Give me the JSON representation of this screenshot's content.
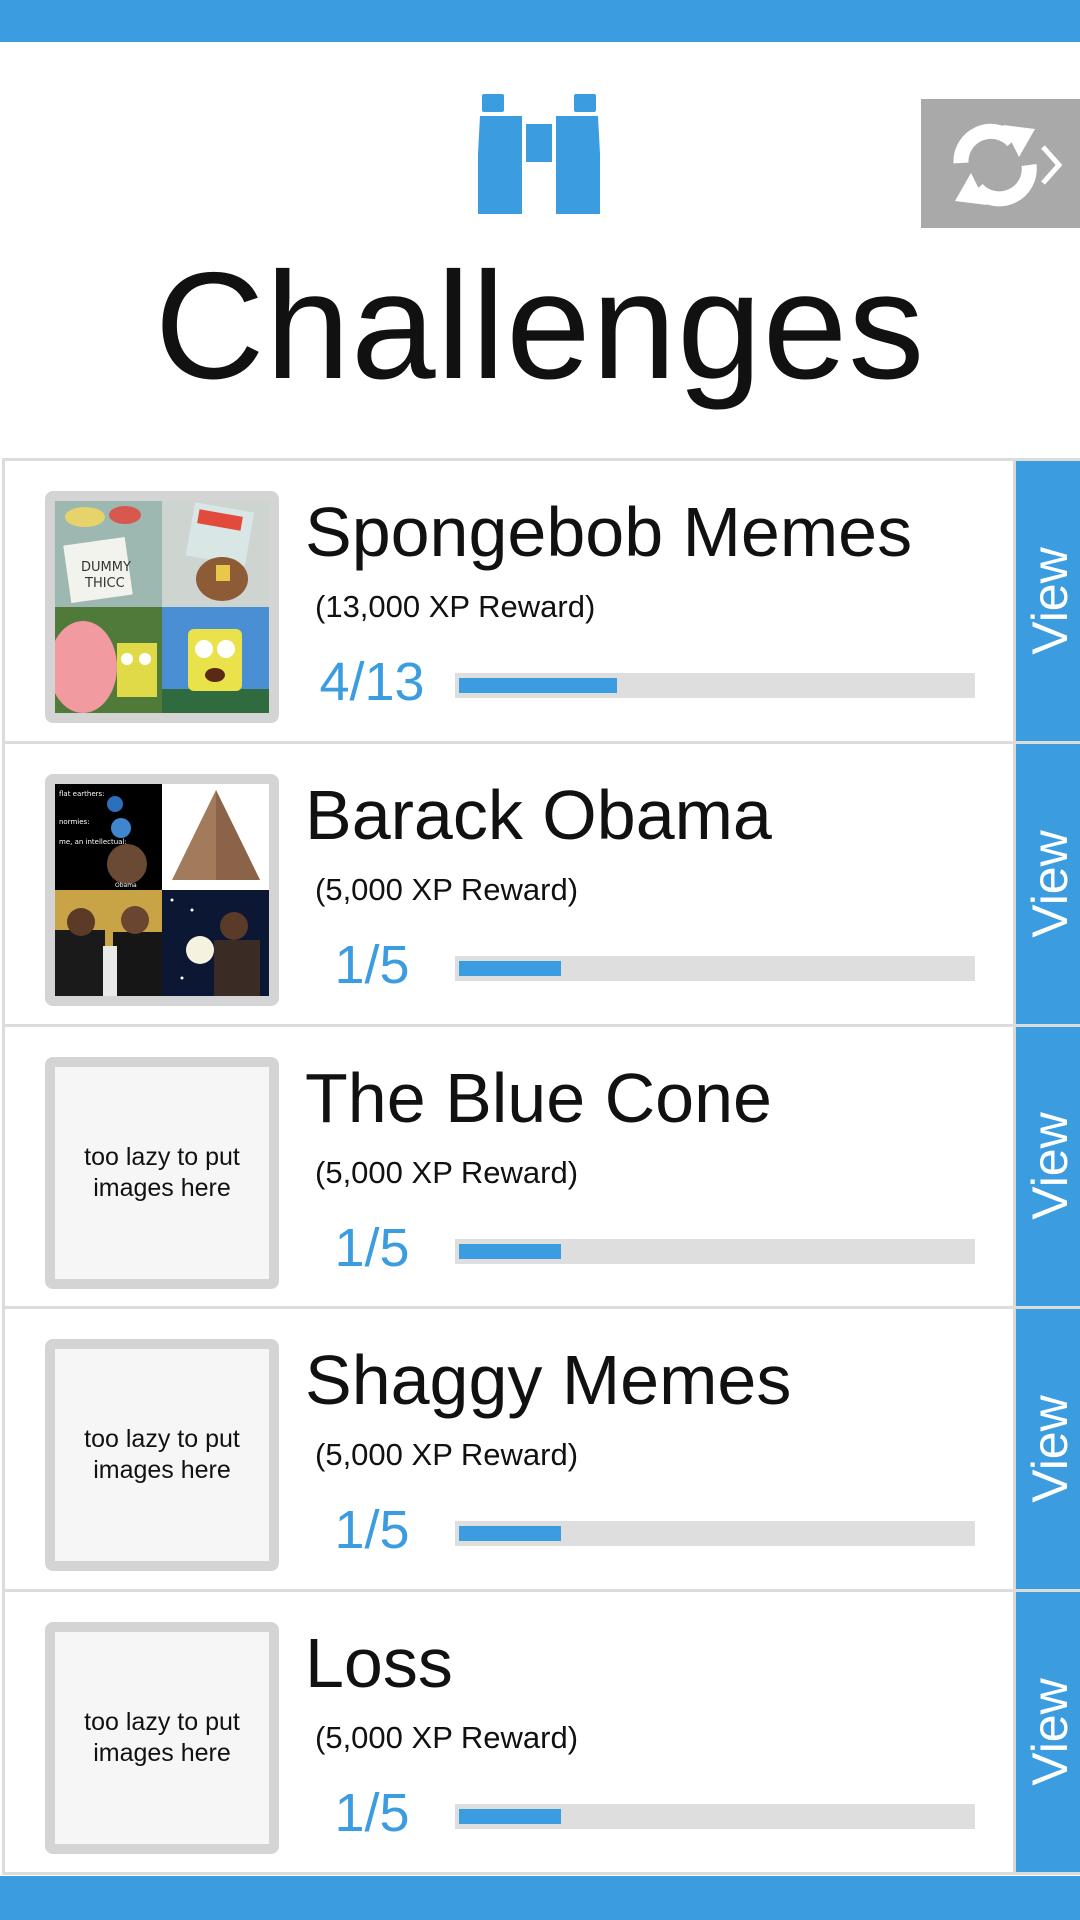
{
  "header": {
    "title": "Challenges",
    "icon": "binoculars-icon",
    "refresh_icon": "refresh-icon"
  },
  "colors": {
    "accent": "#3b9ddf",
    "refresh_bg": "#a9a9a9",
    "track": "#dedede"
  },
  "challenges": [
    {
      "title": "Spongebob Memes",
      "reward": "(13,000 XP Reward)",
      "progress_text": "4/13",
      "progress_fraction": 0.3077,
      "thumbnail": "spongebob-memes-collage",
      "view_label": "View"
    },
    {
      "title": "Barack Obama",
      "reward": "(5,000 XP Reward)",
      "progress_text": "1/5",
      "progress_fraction": 0.2,
      "thumbnail": "barack-obama-memes-collage",
      "thumbnail_caption_lines": [
        "flat earthers:",
        "normies:",
        "me, an intellectual:",
        "Obama"
      ],
      "view_label": "View"
    },
    {
      "title": "The Blue Cone",
      "reward": "(5,000 XP Reward)",
      "progress_text": "1/5",
      "progress_fraction": 0.2,
      "thumbnail_text": "too lazy to put images here",
      "view_label": "View"
    },
    {
      "title": "Shaggy Memes",
      "reward": "(5,000 XP Reward)",
      "progress_text": "1/5",
      "progress_fraction": 0.2,
      "thumbnail_text": "too lazy to put images here",
      "view_label": "View"
    },
    {
      "title": "Loss",
      "reward": "(5,000 XP Reward)",
      "progress_text": "1/5",
      "progress_fraction": 0.2,
      "thumbnail_text": "too lazy to put images here",
      "view_label": "View"
    }
  ]
}
